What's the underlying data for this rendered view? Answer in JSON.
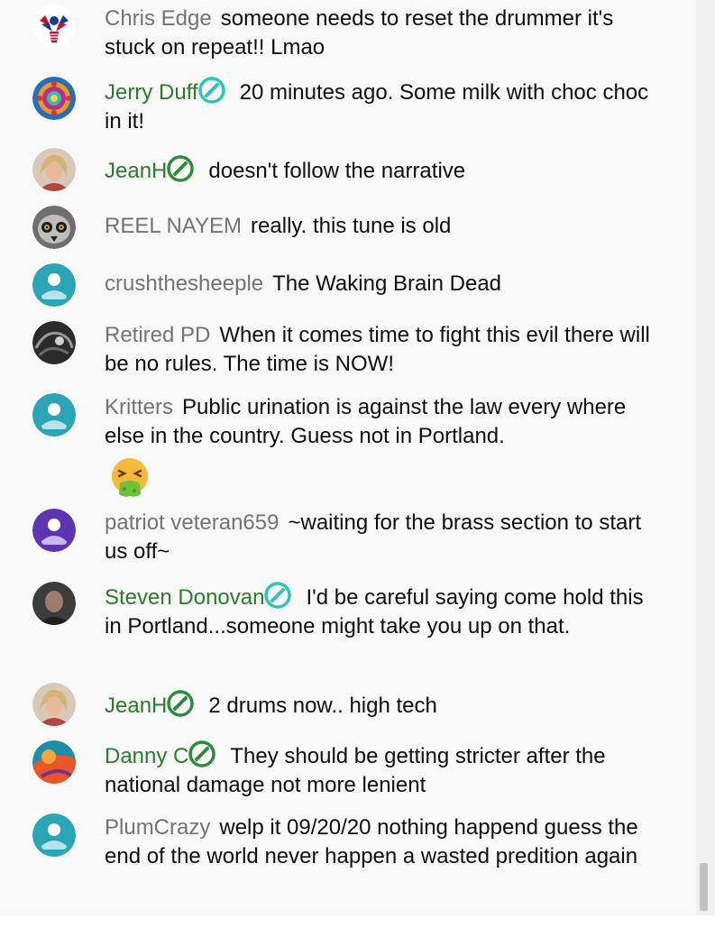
{
  "chat": {
    "messages": [
      {
        "author": "Chris Edge",
        "author_style": "gray",
        "badge": false,
        "avatar": "flag-eagle-avatar",
        "text": "someone needs to reset the drummer it's stuck on repeat!! Lmao"
      },
      {
        "author": "Jerry Duff",
        "author_style": "member",
        "badge": "teal",
        "avatar": "mandala-avatar",
        "text": "20 minutes ago. Some milk with choc choc in it!"
      },
      {
        "author": "JeanH",
        "author_style": "member",
        "badge": "green",
        "avatar": "woman-photo-avatar",
        "text": "doesn't follow the narrative"
      },
      {
        "author": "REEL NAYEM",
        "author_style": "gray",
        "badge": false,
        "avatar": "lemur-avatar",
        "text": "really. this tune is old"
      },
      {
        "author": "crushthesheeple",
        "author_style": "gray",
        "badge": false,
        "avatar": "default-person-avatar",
        "text": "The Waking Brain Dead"
      },
      {
        "author": "Retired PD",
        "author_style": "gray",
        "badge": false,
        "avatar": "dark-photo-avatar",
        "text": "When it comes time to fight this evil there will be no rules. The time is NOW!"
      },
      {
        "author": "Kritters",
        "author_style": "gray",
        "badge": false,
        "avatar": "default-person-avatar",
        "text": "Public urination is against the law every where else in the country. Guess not in Portland.",
        "emoji": "vomiting-face-emoji"
      },
      {
        "author": "patriot veteran659",
        "author_style": "gray",
        "badge": false,
        "avatar": "default-person-avatar-purple",
        "text": "~waiting for the brass section to start us off~"
      },
      {
        "author": "Steven Donovan",
        "author_style": "member",
        "badge": "teal",
        "avatar": "man-photo-avatar",
        "text": "I'd be careful saying come hold this in Portland...someone might take you up on that."
      },
      {
        "author": "JeanH",
        "author_style": "member",
        "badge": "green",
        "avatar": "woman-photo-avatar",
        "text": "2 drums now.. high tech"
      },
      {
        "author": "Danny C",
        "author_style": "member",
        "badge": "green",
        "avatar": "colorful-avatar",
        "text": "They should be getting stricter after the national damage not more lenient"
      },
      {
        "author": "PlumCrazy",
        "author_style": "gray",
        "badge": false,
        "avatar": "default-person-avatar",
        "text": "welp it 09/20/20 nothing happend guess the end of the world never happen a wasted predition again"
      }
    ]
  },
  "colors": {
    "member_name": "#2b7b2b",
    "gray_name": "#737373",
    "text": "#0f0f0f",
    "teal_badge": "#2ec4b6",
    "green_badge": "#2e8b3a",
    "default_avatar_teal": "#2aa5b5",
    "default_avatar_purple": "#5e35b1",
    "background": "#f9f9f9"
  }
}
